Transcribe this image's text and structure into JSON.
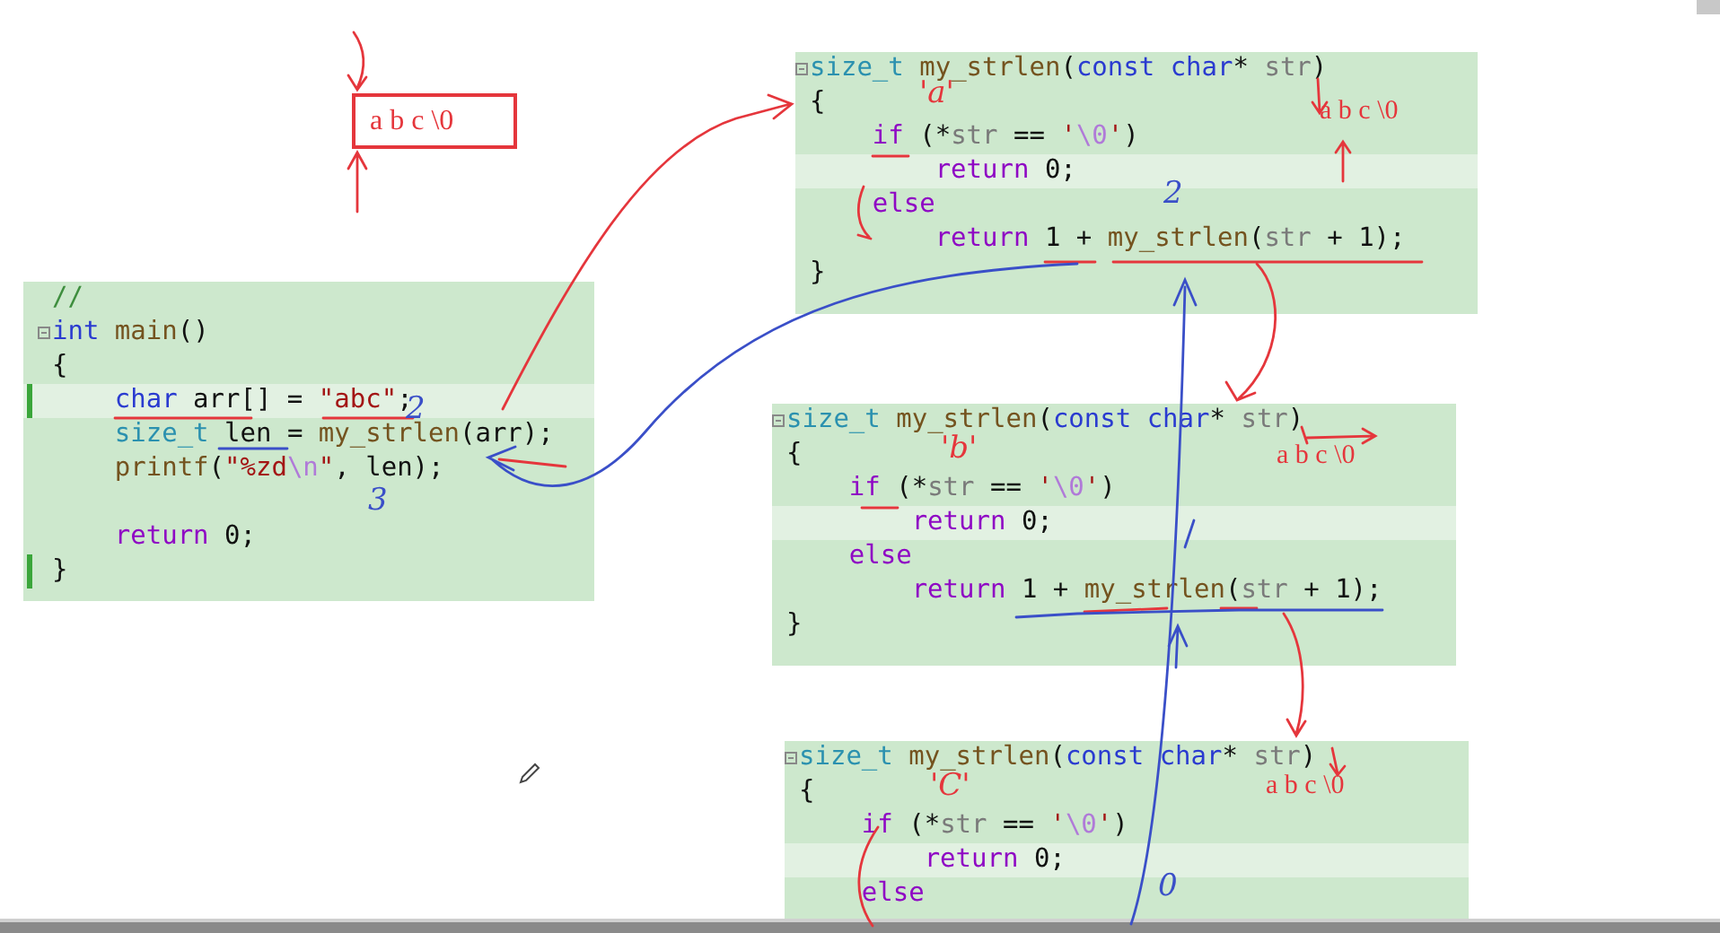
{
  "top_box": {
    "text": "a b c \\0"
  },
  "panels": [
    {
      "lines": [
        {
          "fold": false,
          "changed": false,
          "highlighted": false,
          "tokens": [
            {
              "kind": "comment",
              "text": "//"
            }
          ]
        },
        {
          "fold": true,
          "changed": false,
          "highlighted": false,
          "tokens": [
            {
              "kind": "kw",
              "text": "int"
            },
            {
              "kind": "fn",
              "text": " main"
            },
            {
              "kind": "plain",
              "text": "()"
            }
          ]
        },
        {
          "fold": false,
          "changed": false,
          "highlighted": false,
          "tokens": [
            {
              "kind": "plain",
              "text": "{"
            }
          ]
        },
        {
          "fold": false,
          "changed": true,
          "highlighted": true,
          "tokens": [
            {
              "kind": "kw",
              "text": "    char"
            },
            {
              "kind": "plain",
              "text": " arr[] = "
            },
            {
              "kind": "str",
              "text": "\"abc\""
            },
            {
              "kind": "plain",
              "text": ";"
            }
          ]
        },
        {
          "fold": false,
          "changed": false,
          "highlighted": false,
          "tokens": [
            {
              "kind": "type",
              "text": "    size_t"
            },
            {
              "kind": "plain",
              "text": " len = "
            },
            {
              "kind": "fn",
              "text": "my_strlen"
            },
            {
              "kind": "plain",
              "text": "(arr);"
            }
          ]
        },
        {
          "fold": false,
          "changed": false,
          "highlighted": false,
          "tokens": [
            {
              "kind": "fn",
              "text": "    printf"
            },
            {
              "kind": "plain",
              "text": "("
            },
            {
              "kind": "str",
              "text": "\"%zd"
            },
            {
              "kind": "esc",
              "text": "\\n"
            },
            {
              "kind": "str",
              "text": "\""
            },
            {
              "kind": "plain",
              "text": ", len);"
            }
          ]
        },
        {
          "fold": false,
          "changed": false,
          "highlighted": false
        },
        {
          "fold": false,
          "changed": false,
          "highlighted": false,
          "tokens": [
            {
              "kind": "ctrl",
              "text": "    return"
            },
            {
              "kind": "plain",
              "text": " 0;"
            }
          ]
        },
        {
          "fold": false,
          "changed": true,
          "highlighted": false,
          "tokens": [
            {
              "kind": "plain",
              "text": "}"
            }
          ]
        }
      ]
    },
    {
      "lines": [
        {
          "fold": true,
          "changed": false,
          "highlighted": false,
          "tokens": [
            {
              "kind": "type",
              "text": "size_t"
            },
            {
              "kind": "fn",
              "text": " my_strlen"
            },
            {
              "kind": "plain",
              "text": "("
            },
            {
              "kind": "kw",
              "text": "const"
            },
            {
              "kind": "kw",
              "text": " char"
            },
            {
              "kind": "plain",
              "text": "* "
            },
            {
              "kind": "param",
              "text": "str"
            },
            {
              "kind": "plain",
              "text": ")"
            }
          ]
        },
        {
          "fold": false,
          "changed": false,
          "highlighted": false,
          "tokens": [
            {
              "kind": "plain",
              "text": "{"
            }
          ]
        },
        {
          "fold": false,
          "changed": false,
          "highlighted": false,
          "tokens": [
            {
              "kind": "ctrl",
              "text": "    if"
            },
            {
              "kind": "plain",
              "text": " (*"
            },
            {
              "kind": "param",
              "text": "str"
            },
            {
              "kind": "plain",
              "text": " == "
            },
            {
              "kind": "str",
              "text": "'"
            },
            {
              "kind": "esc",
              "text": "\\0"
            },
            {
              "kind": "str",
              "text": "'"
            },
            {
              "kind": "plain",
              "text": ")"
            }
          ]
        },
        {
          "fold": false,
          "changed": false,
          "highlighted": true,
          "tokens": [
            {
              "kind": "ctrl",
              "text": "        return"
            },
            {
              "kind": "plain",
              "text": " 0;"
            }
          ]
        },
        {
          "fold": false,
          "changed": false,
          "highlighted": false,
          "tokens": [
            {
              "kind": "ctrl",
              "text": "    else"
            }
          ]
        },
        {
          "fold": false,
          "changed": false,
          "highlighted": false,
          "tokens": [
            {
              "kind": "ctrl",
              "text": "        return"
            },
            {
              "kind": "plain",
              "text": " 1 + "
            },
            {
              "kind": "fn",
              "text": "my_strlen"
            },
            {
              "kind": "plain",
              "text": "("
            },
            {
              "kind": "param",
              "text": "str"
            },
            {
              "kind": "plain",
              "text": " + 1);"
            }
          ]
        },
        {
          "fold": false,
          "changed": false,
          "highlighted": false,
          "tokens": [
            {
              "kind": "plain",
              "text": "}"
            }
          ]
        }
      ]
    },
    {
      "lines": [
        {
          "fold": true,
          "changed": false,
          "highlighted": false,
          "tokens": [
            {
              "kind": "type",
              "text": "size_t"
            },
            {
              "kind": "fn",
              "text": " my_strlen"
            },
            {
              "kind": "plain",
              "text": "("
            },
            {
              "kind": "kw",
              "text": "const"
            },
            {
              "kind": "kw",
              "text": " char"
            },
            {
              "kind": "plain",
              "text": "* "
            },
            {
              "kind": "param",
              "text": "str"
            },
            {
              "kind": "plain",
              "text": ")"
            }
          ]
        },
        {
          "fold": false,
          "changed": false,
          "highlighted": false,
          "tokens": [
            {
              "kind": "plain",
              "text": "{"
            }
          ]
        },
        {
          "fold": false,
          "changed": false,
          "highlighted": false,
          "tokens": [
            {
              "kind": "ctrl",
              "text": "    if"
            },
            {
              "kind": "plain",
              "text": " (*"
            },
            {
              "kind": "param",
              "text": "str"
            },
            {
              "kind": "plain",
              "text": " == "
            },
            {
              "kind": "str",
              "text": "'"
            },
            {
              "kind": "esc",
              "text": "\\0"
            },
            {
              "kind": "str",
              "text": "'"
            },
            {
              "kind": "plain",
              "text": ")"
            }
          ]
        },
        {
          "fold": false,
          "changed": false,
          "highlighted": true,
          "tokens": [
            {
              "kind": "ctrl",
              "text": "        return"
            },
            {
              "kind": "plain",
              "text": " 0;"
            }
          ]
        },
        {
          "fold": false,
          "changed": false,
          "highlighted": false,
          "tokens": [
            {
              "kind": "ctrl",
              "text": "    else"
            }
          ]
        },
        {
          "fold": false,
          "changed": false,
          "highlighted": false,
          "tokens": [
            {
              "kind": "ctrl",
              "text": "        return"
            },
            {
              "kind": "plain",
              "text": " 1 + "
            },
            {
              "kind": "fn",
              "text": "my_strlen"
            },
            {
              "kind": "plain",
              "text": "("
            },
            {
              "kind": "param",
              "text": "str"
            },
            {
              "kind": "plain",
              "text": " + 1);"
            }
          ]
        },
        {
          "fold": false,
          "changed": false,
          "highlighted": false,
          "tokens": [
            {
              "kind": "plain",
              "text": "}"
            }
          ]
        }
      ]
    },
    {
      "lines": [
        {
          "fold": true,
          "changed": false,
          "highlighted": false,
          "tokens": [
            {
              "kind": "type",
              "text": "size_t"
            },
            {
              "kind": "fn",
              "text": " my_strlen"
            },
            {
              "kind": "plain",
              "text": "("
            },
            {
              "kind": "kw",
              "text": "const"
            },
            {
              "kind": "kw",
              "text": " char"
            },
            {
              "kind": "plain",
              "text": "* "
            },
            {
              "kind": "param",
              "text": "str"
            },
            {
              "kind": "plain",
              "text": ")"
            }
          ]
        },
        {
          "fold": false,
          "changed": false,
          "highlighted": false,
          "tokens": [
            {
              "kind": "plain",
              "text": "{"
            }
          ]
        },
        {
          "fold": false,
          "changed": false,
          "highlighted": false,
          "tokens": [
            {
              "kind": "ctrl",
              "text": "    if"
            },
            {
              "kind": "plain",
              "text": " (*"
            },
            {
              "kind": "param",
              "text": "str"
            },
            {
              "kind": "plain",
              "text": " == "
            },
            {
              "kind": "str",
              "text": "'"
            },
            {
              "kind": "esc",
              "text": "\\0"
            },
            {
              "kind": "str",
              "text": "'"
            },
            {
              "kind": "plain",
              "text": ")"
            }
          ]
        },
        {
          "fold": false,
          "changed": false,
          "highlighted": true,
          "tokens": [
            {
              "kind": "ctrl",
              "text": "        return"
            },
            {
              "kind": "plain",
              "text": " 0;"
            }
          ]
        },
        {
          "fold": false,
          "changed": false,
          "highlighted": false,
          "tokens": [
            {
              "kind": "ctrl",
              "text": "    else"
            }
          ]
        }
      ]
    }
  ],
  "annotations": [
    {
      "kind": "typed",
      "text": "a b c \\0",
      "color": "#e5363c"
    },
    {
      "kind": "typed",
      "text": "a b c \\0",
      "color": "#e5363c"
    },
    {
      "kind": "typed",
      "text": "a b c \\0",
      "color": "#e5363c"
    },
    {
      "kind": "hand",
      "text": "'a'",
      "color": "#e5363c"
    },
    {
      "kind": "hand",
      "text": "'b'",
      "color": "#e5363c"
    },
    {
      "kind": "hand",
      "text": "'C'",
      "color": "#e5363c"
    },
    {
      "kind": "hand",
      "text": "2",
      "color": "#3a4fc8"
    },
    {
      "kind": "hand",
      "text": "3",
      "color": "#3a4fc8"
    },
    {
      "kind": "hand",
      "text": "2",
      "color": "#3a4fc8"
    },
    {
      "kind": "hand",
      "text": "0",
      "color": "#3a4fc8"
    }
  ]
}
